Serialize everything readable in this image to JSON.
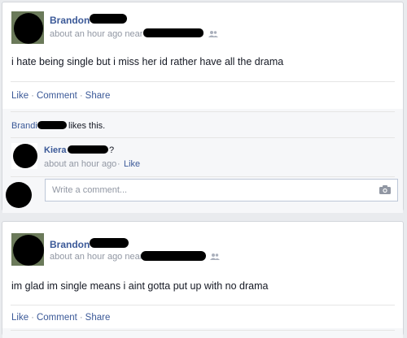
{
  "posts": [
    {
      "author": "Brandon",
      "time": "about an hour ago near",
      "text": "i hate being single but i miss her id rather have all the drama",
      "actions": {
        "like": "Like",
        "comment": "Comment",
        "share": "Share",
        "sep": "·"
      },
      "likes_prefix": "Brandi",
      "likes_suffix": "likes this.",
      "comment": {
        "author": "Kiera",
        "text": "?",
        "time": "about an hour ago",
        "like": "Like"
      },
      "comment_placeholder": "Write a comment..."
    },
    {
      "author": "Brandon",
      "time": "about an hour ago near",
      "text": "im glad im single means i aint gotta put up with no drama",
      "actions": {
        "like": "Like",
        "comment": "Comment",
        "share": "Share",
        "sep": "·"
      }
    }
  ],
  "icons": [
    "people-icon",
    "camera-icon"
  ]
}
